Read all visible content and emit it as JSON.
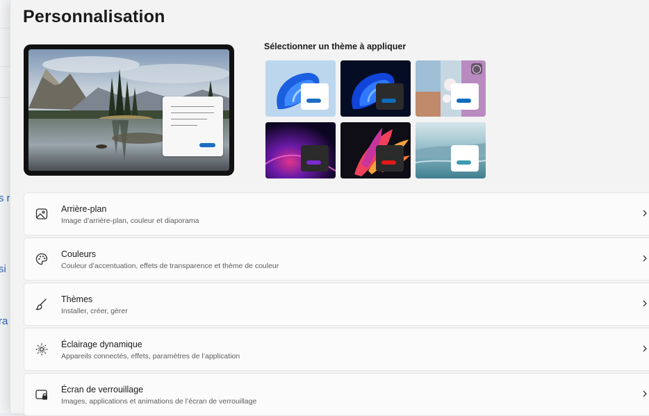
{
  "background_window": {
    "fragments": [
      "s r",
      "si",
      "ra"
    ]
  },
  "page": {
    "title": "Personnalisation"
  },
  "preview": {
    "scene": "lake-island-mountains-photo"
  },
  "themes": {
    "label": "Sélectionner un thème à appliquer",
    "items": [
      {
        "name": "windows-light-bloom",
        "accent": "#1b6ec2",
        "window": "#ffffff"
      },
      {
        "name": "windows-dark-bloom",
        "accent": "#0f6cbd",
        "window": "#2b2b2b"
      },
      {
        "name": "windows-spotlight",
        "accent": "#0f6cbd",
        "window": "#ffffff",
        "badge": "gallery-icon"
      },
      {
        "name": "glow",
        "accent": "#7a2ad0",
        "window": "#2b2b2b"
      },
      {
        "name": "captured-motion",
        "accent": "#e01a1a",
        "window": "#2b2b2b"
      },
      {
        "name": "flow",
        "accent": "#3c9bb1",
        "window": "#ffffff"
      }
    ]
  },
  "settings": [
    {
      "title": "Arrière-plan",
      "subtitle": "Image d’arrière-plan, couleur et diaporama",
      "icon": "image-icon"
    },
    {
      "title": "Couleurs",
      "subtitle": "Couleur d’accentuation, effets de transparence et thème de couleur",
      "icon": "palette-icon"
    },
    {
      "title": "Thèmes",
      "subtitle": "Installer, créer, gérer",
      "icon": "brush-icon"
    },
    {
      "title": "Éclairage dynamique",
      "subtitle": "Appareils connectés, effets, paramètres de l’application",
      "icon": "dynamic-lighting-icon"
    },
    {
      "title": "Écran de verrouillage",
      "subtitle": "Images, applications et animations de l’écran de verrouillage",
      "icon": "lock-screen-icon"
    }
  ]
}
